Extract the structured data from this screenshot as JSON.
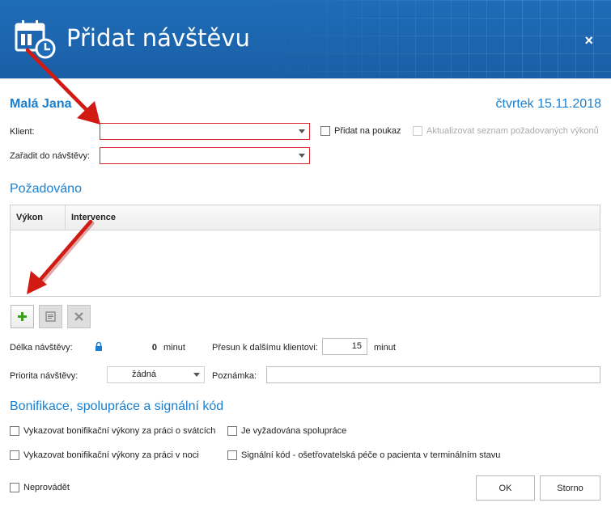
{
  "window": {
    "title": "Přidat návštěvu",
    "close_label": "×"
  },
  "header": {
    "patient_name": "Malá Jana",
    "date": "čtvrtek 15.11.2018"
  },
  "form": {
    "client_label": "Klient:",
    "client_value": "",
    "assign_label": "Zařadit do návštěvy:",
    "assign_value": "",
    "add_to_voucher_label": "Přidat na poukaz",
    "update_list_label": "Aktualizovat seznam požadovaných výkonů"
  },
  "requested": {
    "section_title": "Požadováno",
    "columns": [
      "Výkon",
      "Intervence"
    ],
    "rows": []
  },
  "toolbar": {
    "add_icon": "plus-icon",
    "edit_icon": "edit-icon",
    "delete_icon": "close-icon"
  },
  "visit": {
    "length_label": "Délka návštěvy:",
    "length_value": "0",
    "length_unit": "minut",
    "transfer_label": "Přesun k dalšímu klientovi:",
    "transfer_value": "15",
    "transfer_unit": "minut",
    "priority_label": "Priorita návštěvy:",
    "priority_value": "žádná",
    "note_label": "Poznámka:",
    "note_value": ""
  },
  "bonus": {
    "section_title": "Bonifikace, spolupráce a signální kód",
    "holiday_label": "Vykazovat bonifikační výkony za práci o svátcích",
    "cooperation_label": "Je vyžadována spolupráce",
    "night_label": "Vykazovat bonifikační výkony za práci v noci",
    "signal_label": "Signální kód - ošetřovatelská péče o pacienta v terminálním stavu"
  },
  "footer": {
    "not_perform_label": "Neprovádět",
    "ok_label": "OK",
    "cancel_label": "Storno"
  },
  "colors": {
    "accent": "#1b7fcf",
    "titlebar": "#1f6cb8",
    "required_border": "#d9262e",
    "annotation_arrow": "#d11a14"
  }
}
